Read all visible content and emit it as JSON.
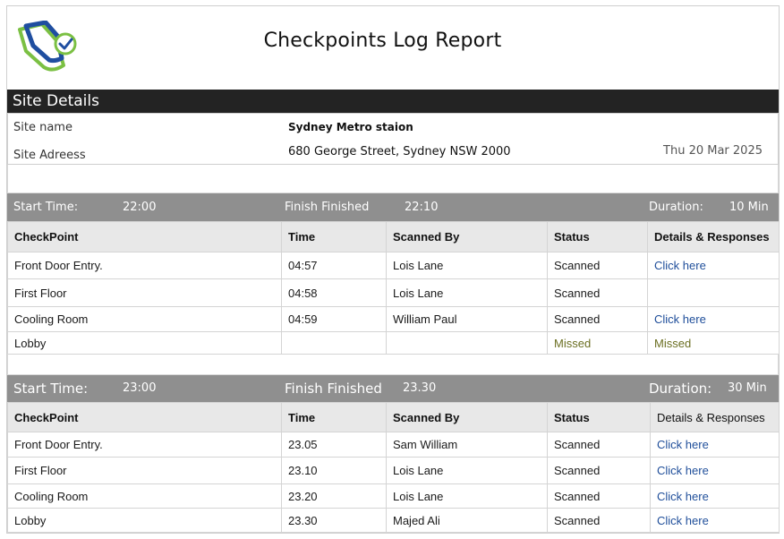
{
  "report": {
    "title": "Checkpoints Log Report",
    "logo_icon": "clipboard-check-logo-icon",
    "brand_colors": {
      "blue": "#1f4ea0",
      "green": "#7bc043"
    }
  },
  "site_details": {
    "header": "Site Details",
    "site_name_label": "Site name",
    "site_name_value": "Sydney Metro staion",
    "site_address_label": "Site Adreess",
    "site_address_value": "680 George Street, Sydney NSW 2000",
    "date": "Thu 20 Mar 2025"
  },
  "columns": [
    "CheckPoint",
    "Time",
    "Scanned By",
    "Status",
    "Details & Responses"
  ],
  "sessions": [
    {
      "start_label": "Start Time:",
      "start_value": "22:00",
      "finish_label": "Finish Finished",
      "finish_value": "22:10",
      "duration_label": "Duration:",
      "duration_value": "10 Min",
      "rows": [
        {
          "checkpoint": "Front Door Entry.",
          "time": "04:57",
          "scanned_by": "Lois Lane",
          "status": "Scanned",
          "details": "Click here"
        },
        {
          "checkpoint": "First Floor",
          "time": "04:58",
          "scanned_by": "Lois Lane",
          "status": "Scanned",
          "details": ""
        },
        {
          "checkpoint": "Cooling Room",
          "time": "04:59",
          "scanned_by": "William Paul",
          "status": "Scanned",
          "details": "Click here"
        },
        {
          "checkpoint": "Lobby",
          "time": "",
          "scanned_by": "",
          "status": "Missed",
          "details": "Missed"
        }
      ]
    },
    {
      "start_label": "Start Time:",
      "start_value": "23:00",
      "finish_label": "Finish Finished",
      "finish_value": "23.30",
      "duration_label": "Duration:",
      "duration_value": "30 Min",
      "rows": [
        {
          "checkpoint": "Front Door Entry.",
          "time": "23.05",
          "scanned_by": "Sam William",
          "status": "Scanned",
          "details": "Click here"
        },
        {
          "checkpoint": "First Floor",
          "time": "23.10",
          "scanned_by": "Lois Lane",
          "status": "Scanned",
          "details": "Click here"
        },
        {
          "checkpoint": "Cooling Room",
          "time": "23.20",
          "scanned_by": "Lois Lane",
          "status": "Scanned",
          "details": "Click here"
        },
        {
          "checkpoint": "Lobby",
          "time": "23.30",
          "scanned_by": "Majed Ali",
          "status": "Scanned",
          "details": "Click here"
        }
      ]
    }
  ]
}
